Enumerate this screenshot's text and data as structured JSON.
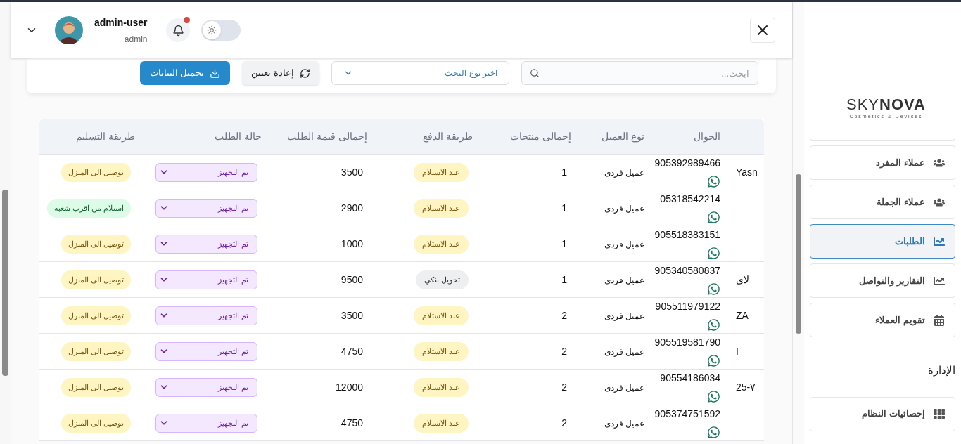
{
  "header": {
    "user_name": "admin-user",
    "user_role": "admin",
    "notifications_unread": true,
    "theme_toggle_on": false
  },
  "filters": {
    "search": {
      "placeholder": "ابحث..."
    },
    "search_type": {
      "placeholder": "اختر نوع البحث"
    },
    "buttons": [
      {
        "kind": "reset",
        "label": "إعادة تعيين"
      },
      {
        "kind": "download",
        "label": "تحميل البيانات"
      }
    ]
  },
  "table": {
    "columns": [
      "الجوال",
      "نوع العميل",
      "إجمالى منتجات",
      "طريقة الدفع",
      "إجمالى قيمة الطلب",
      "حالة الطلب",
      "طريقة التسليم"
    ],
    "rows": [
      {
        "column_1": "Yasn",
        "phone": "905392989466",
        "customer_type": "عميل فردى",
        "products_total": "1",
        "payment": {
          "label": "عند الاستلام",
          "kind": "cod"
        },
        "order_total": "3500",
        "status": "تم التجهيز",
        "delivery": {
          "label": "توصيل الى المنزل",
          "kind": "home"
        }
      },
      {
        "phone": "05318542214",
        "customer_type": "عميل فردى",
        "products_total": "1",
        "payment": {
          "label": "عند الاستلام",
          "kind": "cod"
        },
        "order_total": "2900",
        "status": "تم التجهيز",
        "delivery": {
          "label": "استلام من اقرب شعبة",
          "kind": "pickup"
        }
      },
      {
        "phone": "905518383151",
        "customer_type": "عميل فردى",
        "products_total": "1",
        "payment": {
          "label": "عند الاستلام",
          "kind": "cod"
        },
        "order_total": "1000",
        "status": "تم التجهيز",
        "delivery": {
          "label": "توصيل الى المنزل",
          "kind": "home"
        }
      },
      {
        "column_1": "لاي",
        "phone": "905340580837",
        "customer_type": "عميل فردى",
        "products_total": "1",
        "payment": {
          "label": "تحويل بنكي",
          "kind": "bank"
        },
        "order_total": "9500",
        "status": "تم التجهيز",
        "delivery": {
          "label": "توصيل الى المنزل",
          "kind": "home"
        }
      },
      {
        "column_1": "ZA",
        "phone": "905511979122",
        "customer_type": "عميل فردى",
        "products_total": "2",
        "payment": {
          "label": "عند الاستلام",
          "kind": "cod"
        },
        "order_total": "3500",
        "status": "تم التجهيز",
        "delivery": {
          "label": "توصيل الى المنزل",
          "kind": "home"
        }
      },
      {
        "column_1": "I",
        "phone": "905519581790",
        "customer_type": "عميل فردى",
        "products_total": "2",
        "payment": {
          "label": "عند الاستلام",
          "kind": "cod"
        },
        "order_total": "4750",
        "status": "تم التجهيز",
        "delivery": {
          "label": "توصيل الى المنزل",
          "kind": "home"
        }
      },
      {
        "column_1": "25-٧",
        "phone": "90554186034",
        "customer_type": "عميل فردى",
        "products_total": "2",
        "payment": {
          "label": "عند الاستلام",
          "kind": "cod"
        },
        "order_total": "12000",
        "status": "تم التجهيز",
        "delivery": {
          "label": "توصيل الى المنزل",
          "kind": "home"
        }
      },
      {
        "phone": "905374751592",
        "customer_type": "عميل فردى",
        "products_total": "2",
        "payment": {
          "label": "عند الاستلام",
          "kind": "cod"
        },
        "order_total": "4750",
        "status": "تم التجهيز",
        "delivery": {
          "label": "توصيل الى المنزل",
          "kind": "home"
        }
      }
    ]
  },
  "sidebar": {
    "logo": "SKY**NOVA**",
    "tagline": "Cosmetics & Devices",
    "items": [
      {
        "label": "عملاء المفرد",
        "selected": false
      },
      {
        "label": "عملاء الجملة",
        "selected": false
      },
      {
        "label": "الطلبات",
        "selected": true
      },
      {
        "label": "التقارير والتواصل",
        "selected": false
      },
      {
        "label": "تقويم العملاء",
        "selected": false
      }
    ],
    "section": {
      "title": "الإدارة",
      "items": [
        {
          "label": "إحصائيات النظام",
          "selected": false
        }
      ]
    }
  }
}
